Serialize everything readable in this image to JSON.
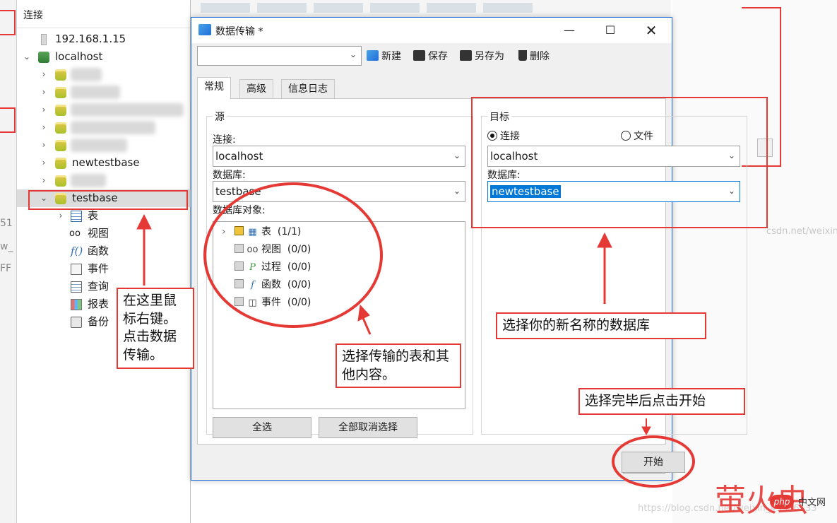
{
  "nav": {
    "header": "连接",
    "items": [
      {
        "label": "192.168.1.15"
      },
      {
        "label": "localhost"
      },
      {
        "label": "newtestbase"
      },
      {
        "label": "testbase"
      },
      {
        "label": "表"
      },
      {
        "label": "视图"
      },
      {
        "label": "函数"
      },
      {
        "label": "事件"
      },
      {
        "label": "查询"
      },
      {
        "label": "报表"
      },
      {
        "label": "备份"
      }
    ]
  },
  "dialog": {
    "title": "数据传输 *",
    "toolbar": {
      "new": "新建",
      "save": "保存",
      "save_as": "另存为",
      "delete": "删除"
    },
    "tabs": [
      "常规",
      "高级",
      "信息日志"
    ],
    "source": {
      "group_title": "源",
      "connection_label": "连接:",
      "connection_value": "localhost",
      "database_label": "数据库:",
      "database_value": "testbase",
      "objects_label": "数据库对象:",
      "objects": [
        {
          "label": "表",
          "count": "(1/1)"
        },
        {
          "label": "视图",
          "count": "(0/0)"
        },
        {
          "label": "过程",
          "count": "(0/0)"
        },
        {
          "label": "函数",
          "count": "(0/0)"
        },
        {
          "label": "事件",
          "count": "(0/0)"
        }
      ],
      "select_all": "全选",
      "deselect_all": "全部取消选择"
    },
    "target": {
      "group_title": "目标",
      "radio_connection": "连接",
      "radio_file": "文件",
      "connection_value": "localhost",
      "database_label": "数据库:",
      "database_value": "newtestbase"
    },
    "start": "开始",
    "close": "关闭"
  },
  "annotations": {
    "right_click": "在这里鼠标右键。点击数据传输。",
    "select_tables": "选择传输的表和其他内容。",
    "select_db": "选择你的新名称的数据库",
    "click_start": "选择完毕后点击开始"
  },
  "watermark": {
    "right": "csdn.net/weixin",
    "bottom": "https://blog.csdn.net/weixin_43356133",
    "logo": "萤火虫",
    "badge": "php",
    "brand": "中文网"
  },
  "colors": {
    "annotation": "#e53935",
    "accent": "#0078d7"
  }
}
